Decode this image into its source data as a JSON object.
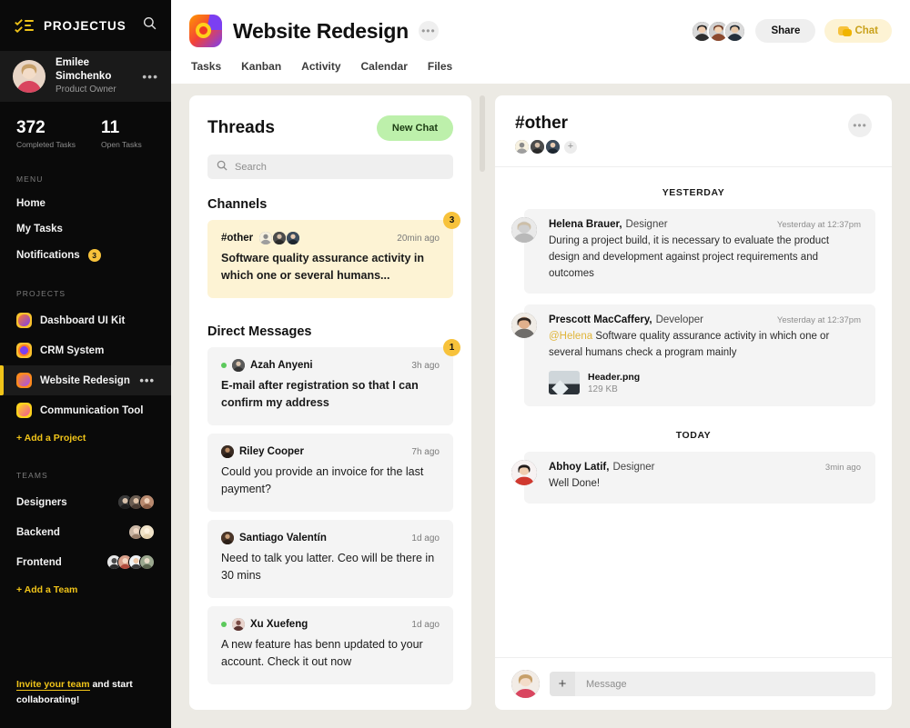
{
  "sidebar": {
    "brand": "PROJECTUS",
    "search_icon": "search-icon",
    "user": {
      "name": "Emilee Simchenko",
      "role": "Product Owner",
      "menu_icon": "dots-horizontal-icon"
    },
    "stats": [
      {
        "value": "372",
        "label": "Completed Tasks"
      },
      {
        "value": "11",
        "label": "Open Tasks"
      }
    ],
    "menu_title": "MENU",
    "menu": [
      {
        "label": "Home",
        "badge": ""
      },
      {
        "label": "My Tasks",
        "badge": ""
      },
      {
        "label": "Notifications",
        "badge": "3"
      }
    ],
    "projects_title": "PROJECTS",
    "projects": [
      {
        "label": "Dashboard UI Kit",
        "c1": "#f9c22e",
        "c2": "#7b3ff2",
        "active": false
      },
      {
        "label": "CRM System",
        "c1": "#f9c22e",
        "c2": "#7b3ff2",
        "active": false
      },
      {
        "label": "Website Redesign",
        "c1": "#ff8a1e",
        "c2": "#a44cf6",
        "active": true
      },
      {
        "label": "Communication Tool",
        "c1": "#ffd21e",
        "c2": "#f2569a",
        "active": false
      }
    ],
    "add_project": "+ Add a Project",
    "teams_title": "TEAMS",
    "teams": [
      {
        "label": "Designers",
        "members": 3
      },
      {
        "label": "Backend",
        "members": 2
      },
      {
        "label": "Frontend",
        "members": 4
      }
    ],
    "add_team": "+ Add a Team",
    "invite": {
      "link": "Invite your team",
      "rest": " and start collaborating!"
    }
  },
  "header": {
    "title": "Website Redesign",
    "menu_icon": "dots-horizontal-icon",
    "tabs": [
      {
        "label": "Tasks"
      },
      {
        "label": "Kanban"
      },
      {
        "label": "Activity"
      },
      {
        "label": "Calendar"
      },
      {
        "label": "Files"
      }
    ],
    "share_label": "Share",
    "chat_label": "Chat"
  },
  "threads": {
    "title": "Threads",
    "new_chat_label": "New Chat",
    "search_placeholder": "Search",
    "search_value": "",
    "channels_title": "Channels",
    "channels": [
      {
        "name": "#other",
        "time": "20min ago",
        "text": "Software quality assurance activity in which one or several humans...",
        "badge": "3",
        "online": false,
        "avatars": 3,
        "highlight": true,
        "bold": true
      }
    ],
    "dm_title": "Direct Messages",
    "dms": [
      {
        "name": "Azah Anyeni",
        "time": "3h ago",
        "text": "E-mail after registration so that I can confirm my address",
        "badge": "1",
        "online": true,
        "avatars": 1,
        "highlight": false,
        "bold": true
      },
      {
        "name": "Riley Cooper",
        "time": "7h ago",
        "text": "Could you provide an invoice for the last payment?",
        "badge": "",
        "online": false,
        "avatars": 1,
        "highlight": false,
        "bold": false
      },
      {
        "name": "Santiago Valentín",
        "time": "1d ago",
        "text": "Need to talk you latter. Ceo will be there in 30 mins",
        "badge": "",
        "online": false,
        "avatars": 1,
        "highlight": false,
        "bold": false
      },
      {
        "name": "Xu Xuefeng",
        "time": "1d ago",
        "text": "A new feature has benn updated to your account. Check it out now",
        "badge": "",
        "online": true,
        "avatars": 1,
        "highlight": false,
        "bold": false
      }
    ]
  },
  "chat": {
    "channel": "#other",
    "member_count": 3,
    "add_member_icon": "plus-icon",
    "menu_icon": "dots-horizontal-icon",
    "groups": [
      {
        "day": "YESTERDAY",
        "messages": [
          {
            "name": "Helena Brauer,",
            "role": "Designer",
            "time": "Yesterday at 12:37pm",
            "mention": "",
            "text": "During a project build, it is necessary to evaluate the product design and development against project requirements and outcomes",
            "attachment": null
          },
          {
            "name": "Prescott MacCaffery,",
            "role": "Developer",
            "time": "Yesterday at 12:37pm",
            "mention": "@Helena",
            "text": " Software quality assurance activity in which one or several humans check a program mainly",
            "attachment": {
              "name": "Header.png",
              "size": "129 KB"
            }
          }
        ]
      },
      {
        "day": "TODAY",
        "messages": [
          {
            "name": "Abhoy Latif,",
            "role": "Designer",
            "time": "3min ago",
            "mention": "",
            "text": "Well Done!",
            "attachment": null
          }
        ]
      }
    ],
    "composer": {
      "placeholder": "Message",
      "value": "",
      "plus_icon": "plus-icon"
    }
  },
  "colors": {
    "accent_yellow": "#f0c419",
    "badge_yellow": "#f7c23b",
    "highlight_bg": "#fdf3d4",
    "new_chat_green": "#bdf0ab",
    "sidebar_bg": "#0a0a0a",
    "page_bg": "#eceae4",
    "online_green": "#5cc95c"
  }
}
